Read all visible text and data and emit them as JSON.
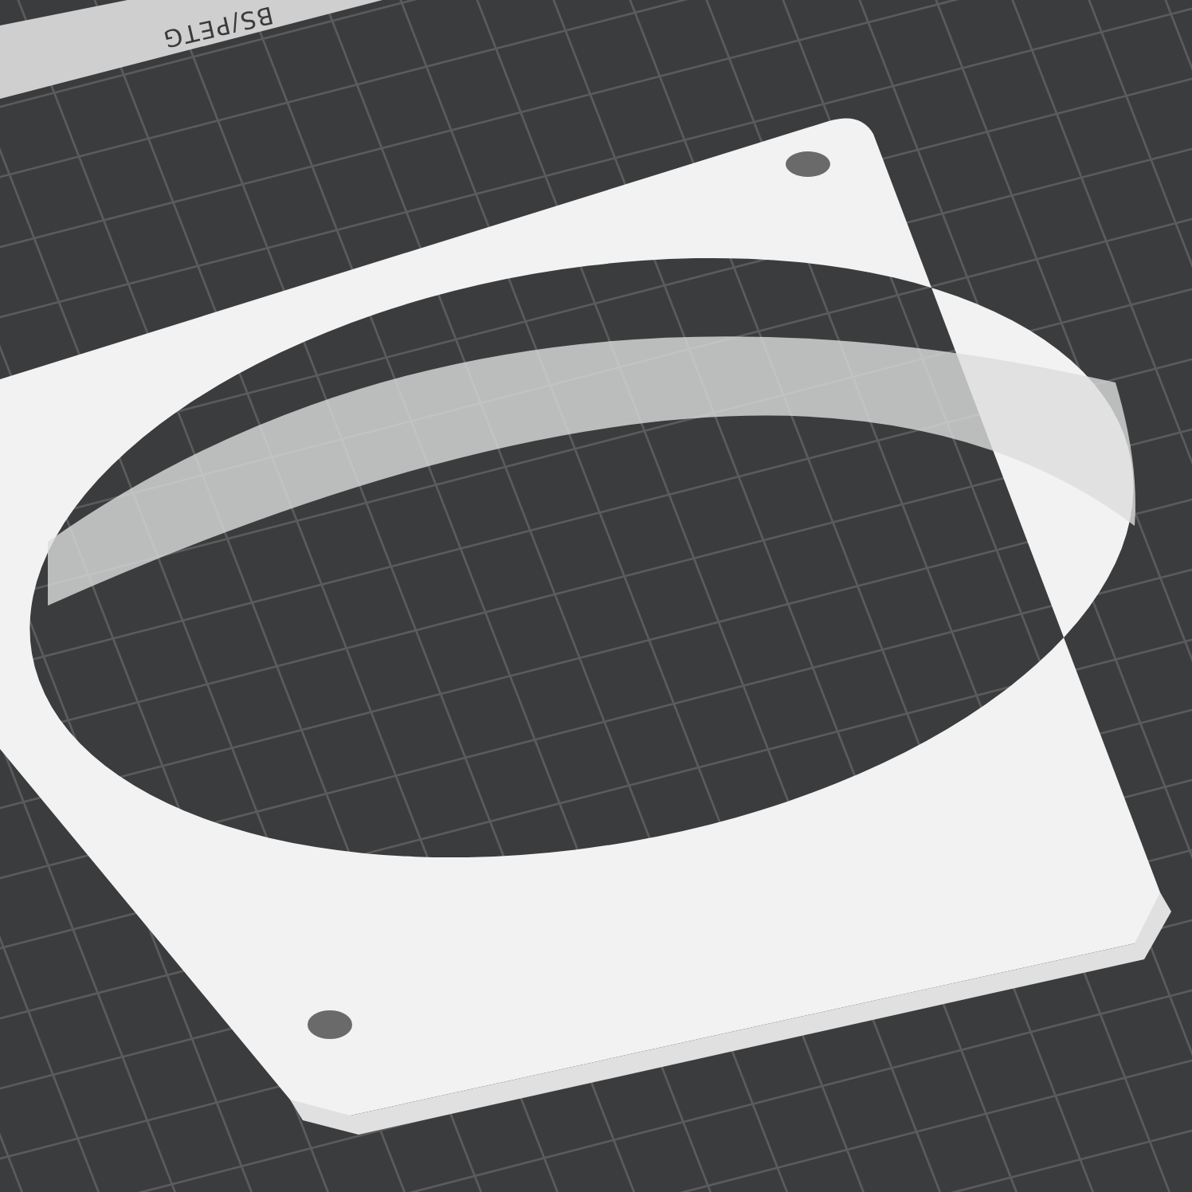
{
  "viewport": {
    "plate_label": "BS/PETG"
  }
}
